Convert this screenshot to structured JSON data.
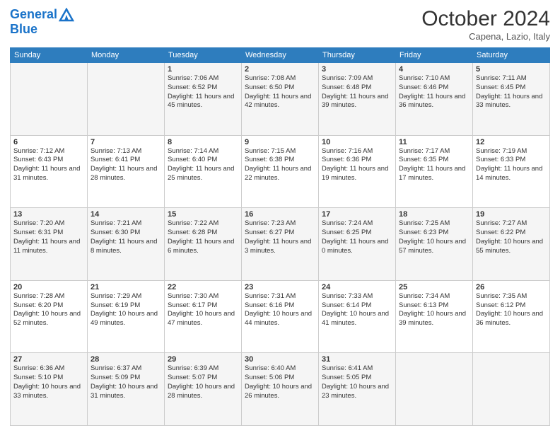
{
  "header": {
    "logo_line1": "General",
    "logo_line2": "Blue",
    "month": "October 2024",
    "location": "Capena, Lazio, Italy"
  },
  "weekdays": [
    "Sunday",
    "Monday",
    "Tuesday",
    "Wednesday",
    "Thursday",
    "Friday",
    "Saturday"
  ],
  "rows": [
    [
      {
        "day": "",
        "sunrise": "",
        "sunset": "",
        "daylight": ""
      },
      {
        "day": "",
        "sunrise": "",
        "sunset": "",
        "daylight": ""
      },
      {
        "day": "1",
        "sunrise": "Sunrise: 7:06 AM",
        "sunset": "Sunset: 6:52 PM",
        "daylight": "Daylight: 11 hours and 45 minutes."
      },
      {
        "day": "2",
        "sunrise": "Sunrise: 7:08 AM",
        "sunset": "Sunset: 6:50 PM",
        "daylight": "Daylight: 11 hours and 42 minutes."
      },
      {
        "day": "3",
        "sunrise": "Sunrise: 7:09 AM",
        "sunset": "Sunset: 6:48 PM",
        "daylight": "Daylight: 11 hours and 39 minutes."
      },
      {
        "day": "4",
        "sunrise": "Sunrise: 7:10 AM",
        "sunset": "Sunset: 6:46 PM",
        "daylight": "Daylight: 11 hours and 36 minutes."
      },
      {
        "day": "5",
        "sunrise": "Sunrise: 7:11 AM",
        "sunset": "Sunset: 6:45 PM",
        "daylight": "Daylight: 11 hours and 33 minutes."
      }
    ],
    [
      {
        "day": "6",
        "sunrise": "Sunrise: 7:12 AM",
        "sunset": "Sunset: 6:43 PM",
        "daylight": "Daylight: 11 hours and 31 minutes."
      },
      {
        "day": "7",
        "sunrise": "Sunrise: 7:13 AM",
        "sunset": "Sunset: 6:41 PM",
        "daylight": "Daylight: 11 hours and 28 minutes."
      },
      {
        "day": "8",
        "sunrise": "Sunrise: 7:14 AM",
        "sunset": "Sunset: 6:40 PM",
        "daylight": "Daylight: 11 hours and 25 minutes."
      },
      {
        "day": "9",
        "sunrise": "Sunrise: 7:15 AM",
        "sunset": "Sunset: 6:38 PM",
        "daylight": "Daylight: 11 hours and 22 minutes."
      },
      {
        "day": "10",
        "sunrise": "Sunrise: 7:16 AM",
        "sunset": "Sunset: 6:36 PM",
        "daylight": "Daylight: 11 hours and 19 minutes."
      },
      {
        "day": "11",
        "sunrise": "Sunrise: 7:17 AM",
        "sunset": "Sunset: 6:35 PM",
        "daylight": "Daylight: 11 hours and 17 minutes."
      },
      {
        "day": "12",
        "sunrise": "Sunrise: 7:19 AM",
        "sunset": "Sunset: 6:33 PM",
        "daylight": "Daylight: 11 hours and 14 minutes."
      }
    ],
    [
      {
        "day": "13",
        "sunrise": "Sunrise: 7:20 AM",
        "sunset": "Sunset: 6:31 PM",
        "daylight": "Daylight: 11 hours and 11 minutes."
      },
      {
        "day": "14",
        "sunrise": "Sunrise: 7:21 AM",
        "sunset": "Sunset: 6:30 PM",
        "daylight": "Daylight: 11 hours and 8 minutes."
      },
      {
        "day": "15",
        "sunrise": "Sunrise: 7:22 AM",
        "sunset": "Sunset: 6:28 PM",
        "daylight": "Daylight: 11 hours and 6 minutes."
      },
      {
        "day": "16",
        "sunrise": "Sunrise: 7:23 AM",
        "sunset": "Sunset: 6:27 PM",
        "daylight": "Daylight: 11 hours and 3 minutes."
      },
      {
        "day": "17",
        "sunrise": "Sunrise: 7:24 AM",
        "sunset": "Sunset: 6:25 PM",
        "daylight": "Daylight: 11 hours and 0 minutes."
      },
      {
        "day": "18",
        "sunrise": "Sunrise: 7:25 AM",
        "sunset": "Sunset: 6:23 PM",
        "daylight": "Daylight: 10 hours and 57 minutes."
      },
      {
        "day": "19",
        "sunrise": "Sunrise: 7:27 AM",
        "sunset": "Sunset: 6:22 PM",
        "daylight": "Daylight: 10 hours and 55 minutes."
      }
    ],
    [
      {
        "day": "20",
        "sunrise": "Sunrise: 7:28 AM",
        "sunset": "Sunset: 6:20 PM",
        "daylight": "Daylight: 10 hours and 52 minutes."
      },
      {
        "day": "21",
        "sunrise": "Sunrise: 7:29 AM",
        "sunset": "Sunset: 6:19 PM",
        "daylight": "Daylight: 10 hours and 49 minutes."
      },
      {
        "day": "22",
        "sunrise": "Sunrise: 7:30 AM",
        "sunset": "Sunset: 6:17 PM",
        "daylight": "Daylight: 10 hours and 47 minutes."
      },
      {
        "day": "23",
        "sunrise": "Sunrise: 7:31 AM",
        "sunset": "Sunset: 6:16 PM",
        "daylight": "Daylight: 10 hours and 44 minutes."
      },
      {
        "day": "24",
        "sunrise": "Sunrise: 7:33 AM",
        "sunset": "Sunset: 6:14 PM",
        "daylight": "Daylight: 10 hours and 41 minutes."
      },
      {
        "day": "25",
        "sunrise": "Sunrise: 7:34 AM",
        "sunset": "Sunset: 6:13 PM",
        "daylight": "Daylight: 10 hours and 39 minutes."
      },
      {
        "day": "26",
        "sunrise": "Sunrise: 7:35 AM",
        "sunset": "Sunset: 6:12 PM",
        "daylight": "Daylight: 10 hours and 36 minutes."
      }
    ],
    [
      {
        "day": "27",
        "sunrise": "Sunrise: 6:36 AM",
        "sunset": "Sunset: 5:10 PM",
        "daylight": "Daylight: 10 hours and 33 minutes."
      },
      {
        "day": "28",
        "sunrise": "Sunrise: 6:37 AM",
        "sunset": "Sunset: 5:09 PM",
        "daylight": "Daylight: 10 hours and 31 minutes."
      },
      {
        "day": "29",
        "sunrise": "Sunrise: 6:39 AM",
        "sunset": "Sunset: 5:07 PM",
        "daylight": "Daylight: 10 hours and 28 minutes."
      },
      {
        "day": "30",
        "sunrise": "Sunrise: 6:40 AM",
        "sunset": "Sunset: 5:06 PM",
        "daylight": "Daylight: 10 hours and 26 minutes."
      },
      {
        "day": "31",
        "sunrise": "Sunrise: 6:41 AM",
        "sunset": "Sunset: 5:05 PM",
        "daylight": "Daylight: 10 hours and 23 minutes."
      },
      {
        "day": "",
        "sunrise": "",
        "sunset": "",
        "daylight": ""
      },
      {
        "day": "",
        "sunrise": "",
        "sunset": "",
        "daylight": ""
      }
    ]
  ]
}
